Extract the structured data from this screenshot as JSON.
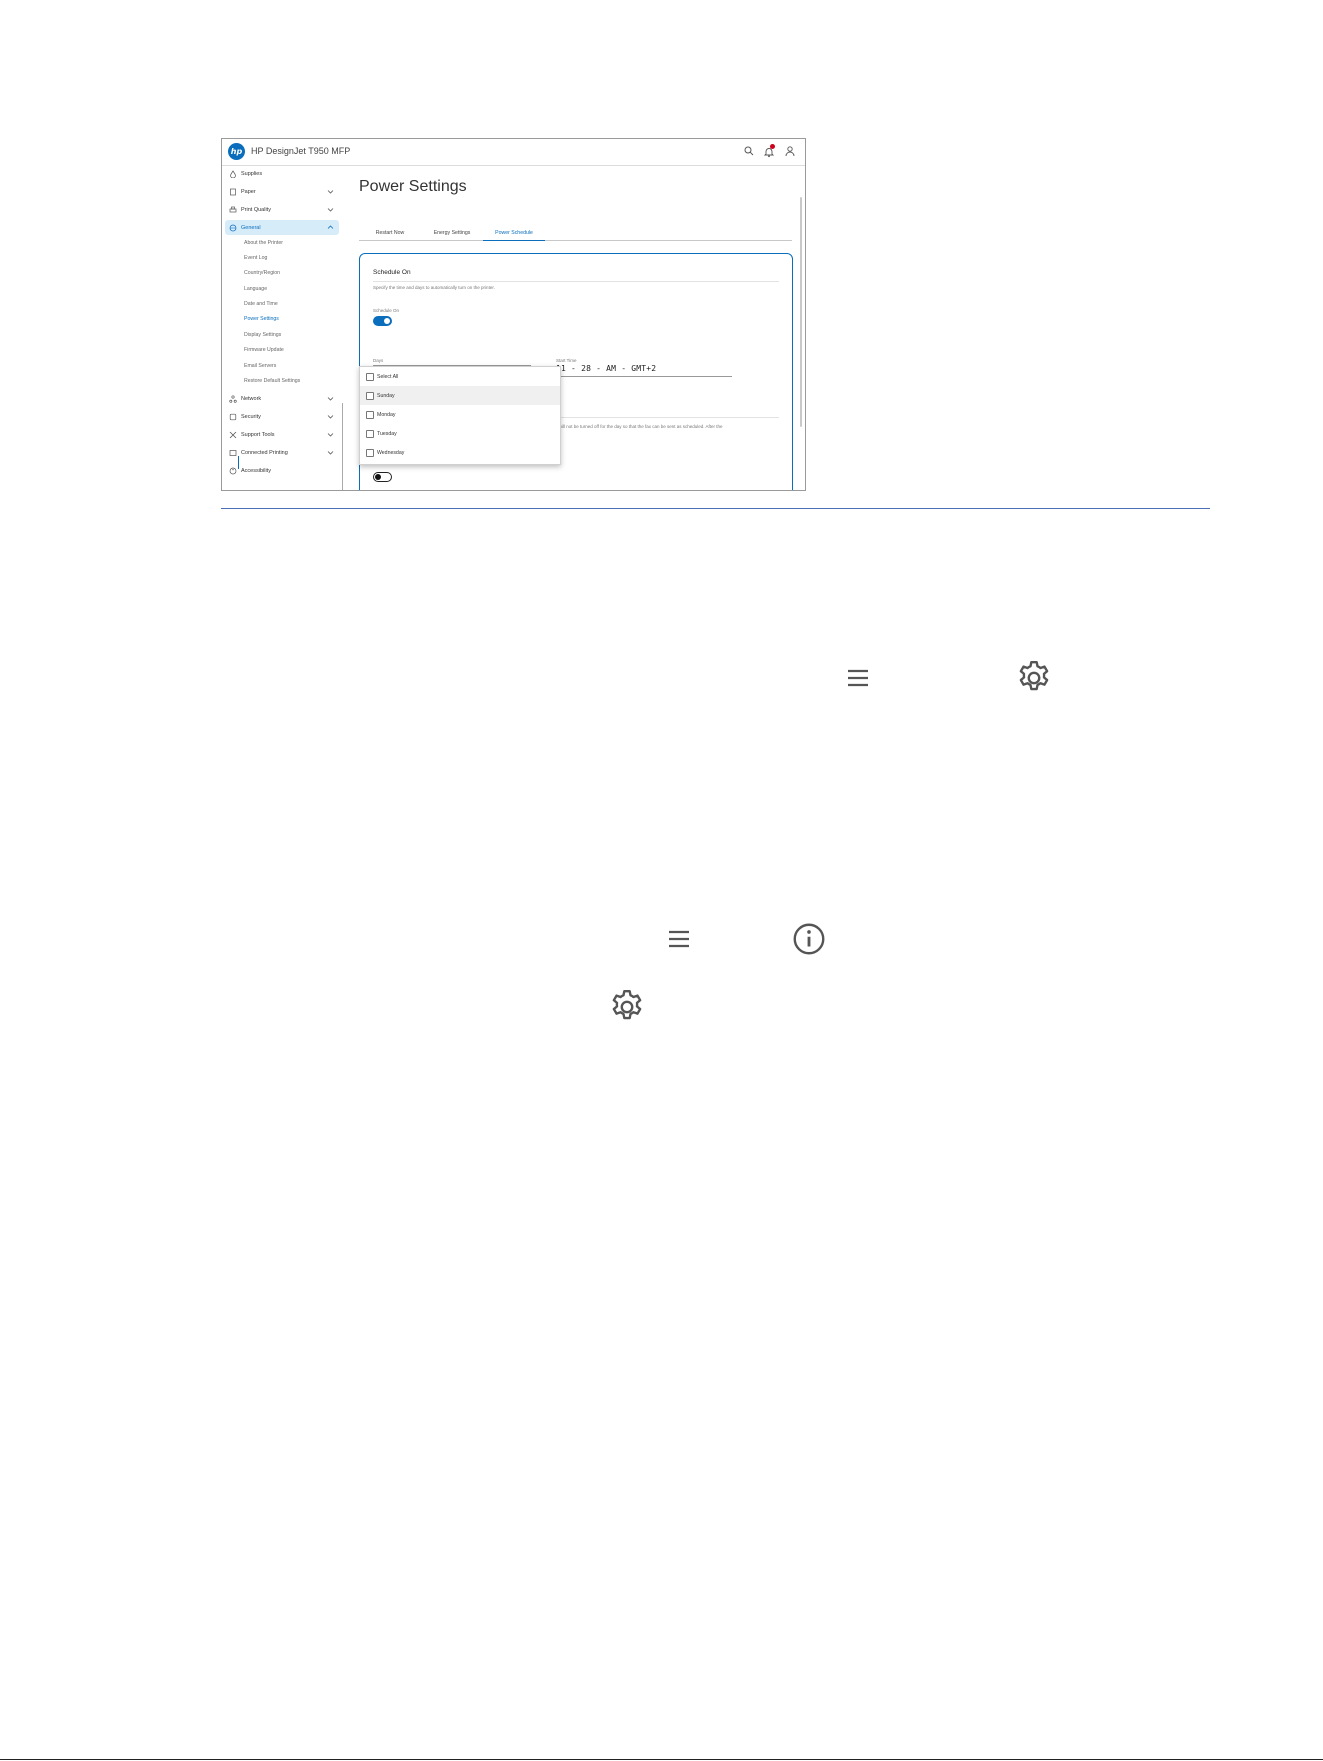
{
  "app": {
    "title": "HP DesignJet T950 MFP",
    "logo_text": "hp",
    "accent_color": "#0a6ebd",
    "notification_color": "#d0021b"
  },
  "header_icons": [
    "search-icon",
    "bell-icon",
    "user-icon"
  ],
  "sidebar": {
    "items": [
      {
        "label": "Supplies",
        "icon": "drop-icon"
      },
      {
        "label": "Paper",
        "icon": "paper-icon"
      },
      {
        "label": "Print Quality",
        "icon": "printer-icon"
      },
      {
        "label": "General",
        "icon": "globe-icon"
      },
      {
        "label": "Network",
        "icon": "network-icon"
      },
      {
        "label": "Security",
        "icon": "shield-icon"
      },
      {
        "label": "Support Tools",
        "icon": "tools-icon"
      },
      {
        "label": "Connected Printing",
        "icon": "cloud-icon"
      },
      {
        "label": "Accessibility",
        "icon": "accessibility-icon"
      }
    ],
    "general_subitems": [
      "About the Printer",
      "Event Log",
      "Country/Region",
      "Language",
      "Date and Time",
      "Power Settings",
      "Display Settings",
      "Firmware Update",
      "Email Servers",
      "Restore Default Settings"
    ],
    "active_subitem": "Power Settings"
  },
  "main": {
    "title": "Power Settings",
    "tabs": [
      "Restart Now",
      "Energy Settings",
      "Power Schedule"
    ],
    "active_tab": "Power Schedule",
    "card": {
      "title": "Schedule On",
      "description": "Specify the time and days to automatically turn on the printer.",
      "toggle_label": "Schedule On",
      "toggle_on": true,
      "days_label": "Days",
      "start_time_label": "Start Time",
      "start_time_value": "11 - 28 - AM - GMT+2",
      "note": "r will not be turned off for the day so that the fax can be sent as scheduled. After the",
      "second_toggle_on": false
    },
    "days_dropdown": {
      "options": [
        "Select All",
        "Sunday",
        "Monday",
        "Tuesday",
        "Wednesday"
      ],
      "highlighted": "Sunday"
    }
  },
  "standalone_icons": [
    "menu-icon",
    "gear-icon",
    "menu-icon",
    "info-icon",
    "gear-icon"
  ]
}
